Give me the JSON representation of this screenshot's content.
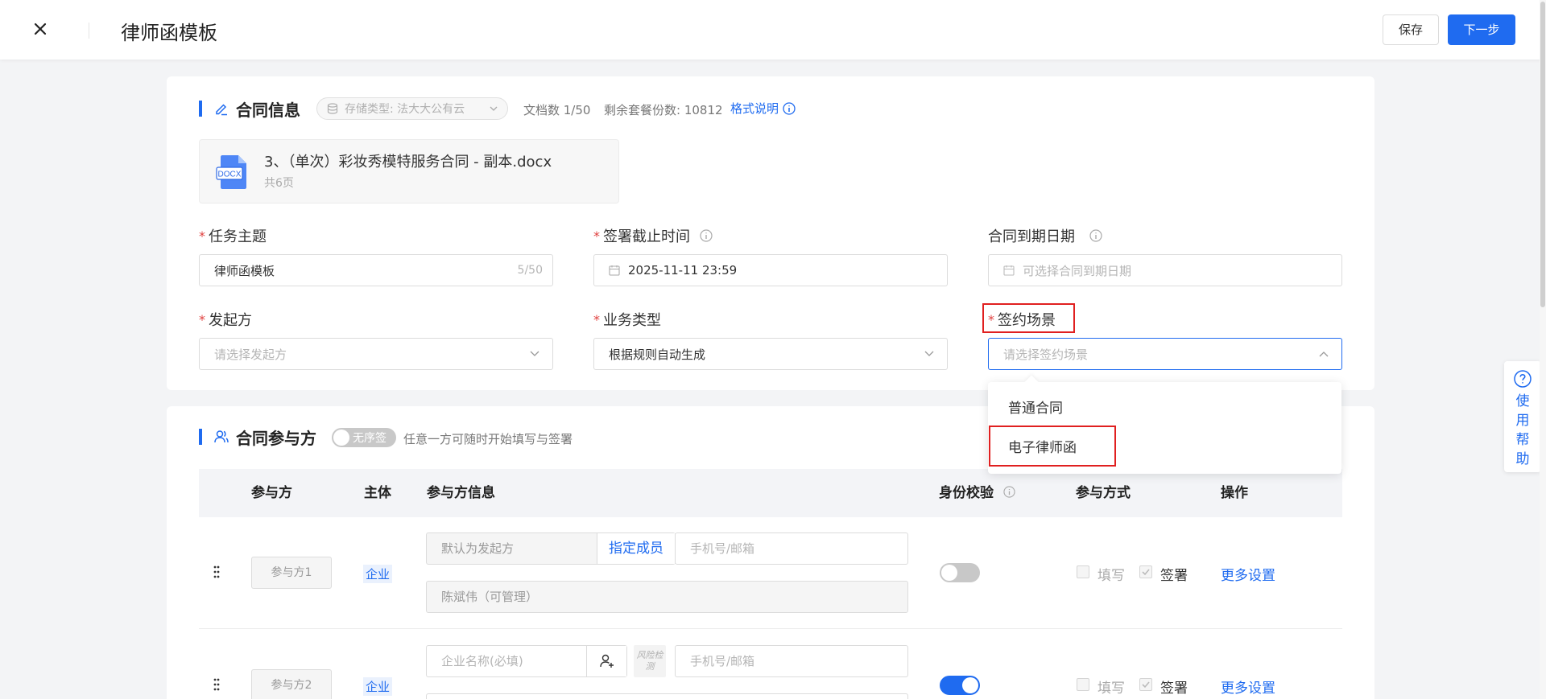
{
  "header": {
    "title": "律师函模板",
    "save_label": "保存",
    "next_label": "下一步"
  },
  "contract_info": {
    "section_title": "合同信息",
    "storage_type": "存储类型: 法大大公有云",
    "doc_count": "文档数 1/50",
    "remaining": "剩余套餐份数: 10812",
    "format_help": "格式说明",
    "file": {
      "name": "3、（单次）彩妆秀模特服务合同 - 副本.docx",
      "pages": "共6页",
      "icon_text": "DOCX"
    },
    "fields": {
      "task_subject": {
        "label": "任务主题",
        "value": "律师函模板",
        "count": "5/50"
      },
      "sign_deadline": {
        "label": "签署截止时间",
        "value": "2025-11-11 23:59"
      },
      "expiry_date": {
        "label": "合同到期日期",
        "placeholder": "可选择合同到期日期"
      },
      "initiator": {
        "label": "发起方",
        "placeholder": "请选择发起方"
      },
      "business_type": {
        "label": "业务类型",
        "value": "根据规则自动生成"
      },
      "sign_scene": {
        "label": "签约场景",
        "placeholder": "请选择签约场景"
      }
    },
    "scene_options": [
      "普通合同",
      "电子律师函"
    ]
  },
  "participants": {
    "section_title": "合同参与方",
    "order_toggle": "无序签",
    "order_hint": "任意一方可随时开始填写与签署",
    "columns": [
      "参与方",
      "主体",
      "参与方信息",
      "身份校验",
      "参与方式",
      "操作"
    ],
    "rows": [
      {
        "name": "参与方1",
        "entity": "企业",
        "initiator_default": "默认为发起方",
        "assign": "指定成员",
        "contact_placeholder": "手机号/邮箱",
        "member": "陈斌伟（可管理）",
        "verify_on": false,
        "fill": "填写",
        "sign": "签署",
        "more": "更多设置"
      },
      {
        "name": "参与方2",
        "entity": "企业",
        "company_placeholder": "企业名称(必填)",
        "risk": "风险检测",
        "contact_placeholder": "手机号/邮箱",
        "verify_on": true,
        "fill": "填写",
        "sign": "签署",
        "more": "更多设置"
      }
    ]
  },
  "help": {
    "label": "使用帮助"
  },
  "colors": {
    "accent": "#1f6bf0",
    "required": "#e0403f",
    "highlight": "#e02020"
  }
}
